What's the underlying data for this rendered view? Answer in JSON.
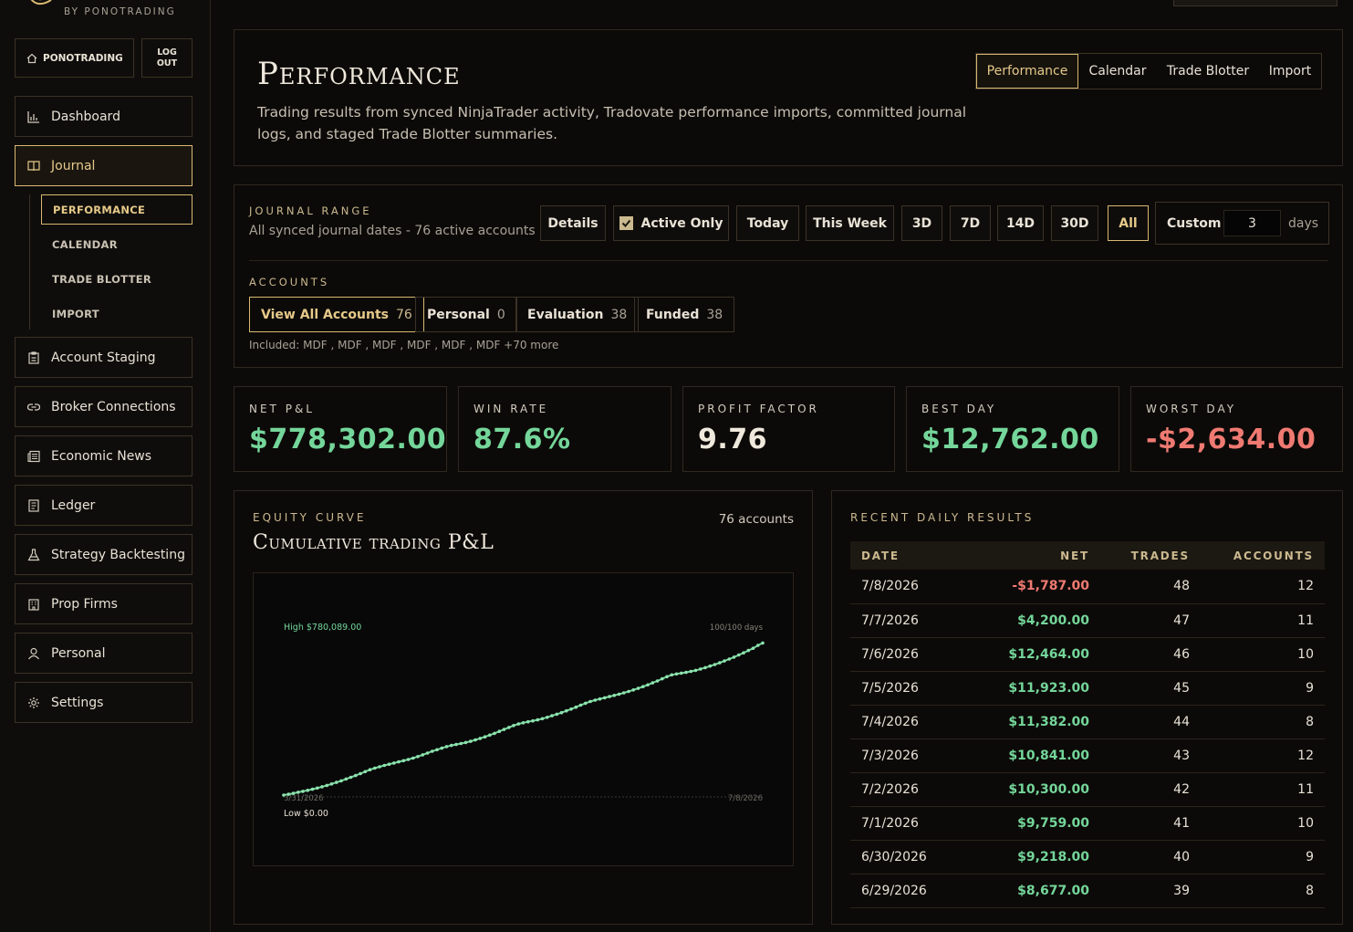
{
  "brand": {
    "tagline": "BY PONOTRADING"
  },
  "account": {
    "name": "PONOTRADING",
    "logout_line1": "LOG",
    "logout_line2": "OUT"
  },
  "nav": {
    "dashboard": "Dashboard",
    "journal": "Journal",
    "journal_sub": [
      "PERFORMANCE",
      "CALENDAR",
      "TRADE BLOTTER",
      "IMPORT"
    ],
    "account_staging": "Account Staging",
    "broker_connections": "Broker Connections",
    "economic_news": "Economic News",
    "ledger": "Ledger",
    "strategy_backtesting": "Strategy Backtesting",
    "prop_firms": "Prop Firms",
    "personal": "Personal",
    "settings": "Settings"
  },
  "header": {
    "title": "Performance",
    "description": "Trading results from synced NinjaTrader activity, Tradovate performance imports, committed journal logs, and staged Trade Blotter summaries.",
    "tabs": [
      "Performance",
      "Calendar",
      "Trade Blotter",
      "Import"
    ],
    "active_tab": "Performance"
  },
  "range": {
    "label": "JOURNAL RANGE",
    "summary": "All synced journal dates - 76 active accounts",
    "buttons": {
      "details": "Details",
      "active_only": "Active Only",
      "today": "Today",
      "this_week": "This Week",
      "d3": "3D",
      "d7": "7D",
      "d14": "14D",
      "d30": "30D",
      "all": "All"
    },
    "active_only_checked": true,
    "selected": "All",
    "custom_label": "Custom",
    "custom_value": "3",
    "custom_unit": "days"
  },
  "accounts": {
    "label": "ACCOUNTS",
    "chips": [
      {
        "label": "View All Accounts",
        "count": "76"
      },
      {
        "label": "Personal",
        "count": "0"
      },
      {
        "label": "Evaluation",
        "count": "38"
      },
      {
        "label": "Funded",
        "count": "38"
      }
    ],
    "included": "Included: MDF , MDF , MDF , MDF , MDF , MDF +70 more"
  },
  "stats": [
    {
      "label": "NET P&L",
      "value": "$778,302.00",
      "color": "#74d69a"
    },
    {
      "label": "WIN RATE",
      "value": "87.6%",
      "color": "#74d69a"
    },
    {
      "label": "PROFIT FACTOR",
      "value": "9.76",
      "color": "#efe8dc"
    },
    {
      "label": "BEST DAY",
      "value": "$12,762.00",
      "color": "#74d69a"
    },
    {
      "label": "WORST DAY",
      "value": "-$2,634.00",
      "color": "#ef7a72"
    }
  ],
  "equity": {
    "label": "EQUITY CURVE",
    "title": "Cumulative trading P&L",
    "accounts_note": "76 accounts",
    "high_label": "High $780,089.00",
    "low_label": "Low $0.00",
    "days_label": "100/100 days",
    "start_date": "3/31/2026",
    "end_date": "7/8/2026"
  },
  "chart_data": {
    "type": "line",
    "title": "Cumulative trading P&L",
    "x_start": "3/31/2026",
    "x_end": "7/8/2026",
    "ylim": [
      0,
      780089
    ],
    "series": [
      {
        "values": [
          0,
          4000,
          9000,
          14500,
          19000,
          24500,
          30000,
          36000,
          42500,
          49500,
          57000,
          65000,
          73000,
          82000,
          91000,
          100000,
          110000,
          120000,
          130000,
          138000,
          145000,
          152000,
          158000,
          164000,
          170000,
          176000,
          182000,
          189000,
          197000,
          206000,
          215000,
          224000,
          232000,
          240000,
          248000,
          254000,
          259000,
          264000,
          269000,
          275000,
          282000,
          290000,
          298000,
          307000,
          316000,
          326000,
          336000,
          346000,
          356000,
          364000,
          370000,
          375000,
          380000,
          385000,
          391000,
          398000,
          406000,
          414000,
          422000,
          431000,
          440000,
          450000,
          460000,
          470000,
          479000,
          486000,
          492000,
          498000,
          504000,
          510000,
          516000,
          523000,
          530000,
          538000,
          546000,
          555000,
          564000,
          574000,
          584000,
          595000,
          606000,
          615000,
          620000,
          624000,
          628000,
          633000,
          638000,
          645000,
          652000,
          660000,
          668000,
          677000,
          686000,
          696000,
          706000,
          717000,
          728000,
          740000,
          751000,
          766000,
          778302
        ]
      }
    ]
  },
  "daily": {
    "label": "RECENT DAILY RESULTS",
    "columns": [
      "DATE",
      "NET",
      "TRADES",
      "ACCOUNTS"
    ],
    "rows": [
      {
        "date": "7/8/2026",
        "net": "-$1,787.00",
        "trades": "48",
        "accounts": "12",
        "neg": true
      },
      {
        "date": "7/7/2026",
        "net": "$4,200.00",
        "trades": "47",
        "accounts": "11"
      },
      {
        "date": "7/6/2026",
        "net": "$12,464.00",
        "trades": "46",
        "accounts": "10"
      },
      {
        "date": "7/5/2026",
        "net": "$11,923.00",
        "trades": "45",
        "accounts": "9"
      },
      {
        "date": "7/4/2026",
        "net": "$11,382.00",
        "trades": "44",
        "accounts": "8"
      },
      {
        "date": "7/3/2026",
        "net": "$10,841.00",
        "trades": "43",
        "accounts": "12"
      },
      {
        "date": "7/2/2026",
        "net": "$10,300.00",
        "trades": "42",
        "accounts": "11"
      },
      {
        "date": "7/1/2026",
        "net": "$9,759.00",
        "trades": "41",
        "accounts": "10"
      },
      {
        "date": "6/30/2026",
        "net": "$9,218.00",
        "trades": "40",
        "accounts": "9"
      },
      {
        "date": "6/29/2026",
        "net": "$8,677.00",
        "trades": "39",
        "accounts": "8"
      }
    ]
  },
  "colors": {
    "accent": "#d8b872",
    "positive": "#74d69a",
    "negative": "#ef7a72"
  }
}
